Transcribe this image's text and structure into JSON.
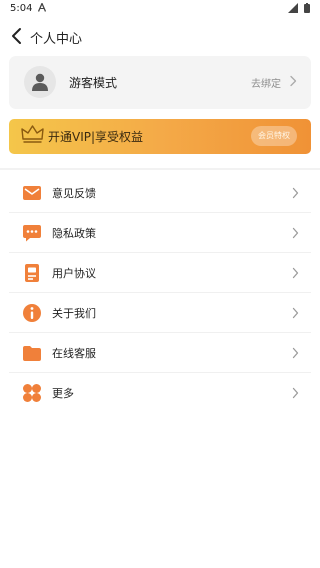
{
  "status_bar": {
    "time": "5:04"
  },
  "header": {
    "title": "个人中心",
    "back_icon": "chevron-left-icon"
  },
  "profile": {
    "name": "游客模式",
    "bind_link": "去绑定"
  },
  "vip": {
    "text": "开通VIP|享受权益",
    "button": "会员特权"
  },
  "colors": {
    "accent": "#f0803a",
    "vip_gradient_start": "#f4c64a",
    "vip_gradient_end": "#f09236"
  },
  "menu": [
    {
      "label": "意见反馈",
      "icon": "mail-icon"
    },
    {
      "label": "隐私政策",
      "icon": "chat-bubble-icon"
    },
    {
      "label": "用户协议",
      "icon": "document-icon"
    },
    {
      "label": "关于我们",
      "icon": "info-icon"
    },
    {
      "label": "在线客服",
      "icon": "folder-icon"
    },
    {
      "label": "更多",
      "icon": "grid-icon"
    }
  ]
}
